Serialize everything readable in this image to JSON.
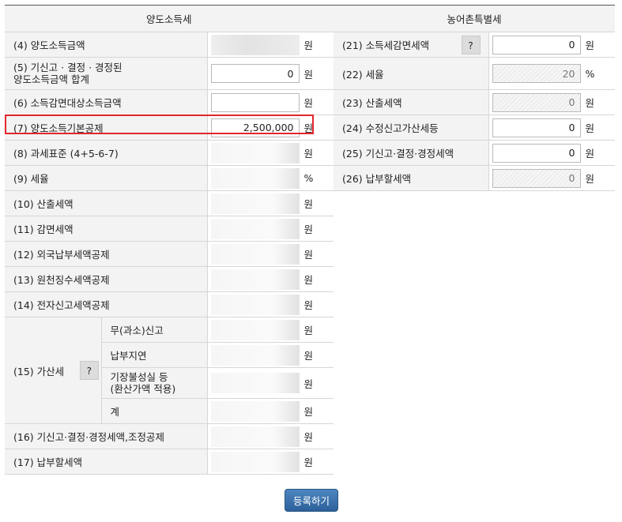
{
  "transfer_tax": {
    "header": "양도소득세",
    "rows": {
      "r4": {
        "label": "(4) 양도소득금액",
        "unit": "원"
      },
      "r5": {
        "label1": "(5) 기신고 · 결정 · 경정된",
        "label2": "양도소득금액 합계",
        "value": "0",
        "unit": "원"
      },
      "r6": {
        "label": "(6) 소득감면대상소득금액",
        "value": "",
        "unit": "원"
      },
      "r7": {
        "label": "(7) 양도소득기본공제",
        "value": "2,500,000",
        "unit": "원"
      },
      "r8": {
        "label": "(8) 과세표준 (4+5-6-7)",
        "unit": "원"
      },
      "r9": {
        "label": "(9) 세율",
        "unit": "%"
      },
      "r10": {
        "label": "(10) 산출세액",
        "unit": "원"
      },
      "r11": {
        "label": "(11) 감면세액",
        "unit": "원"
      },
      "r12": {
        "label": "(12) 외국납부세액공제",
        "unit": "원"
      },
      "r13": {
        "label": "(13) 원천징수세액공제",
        "unit": "원"
      },
      "r14": {
        "label": "(14) 전자신고세액공제",
        "unit": "원"
      },
      "r15": {
        "label": "(15) 가산세",
        "help": "?",
        "sub": [
          {
            "label": "무(과소)신고",
            "unit": "원"
          },
          {
            "label": "납부지연",
            "unit": "원"
          },
          {
            "label1": "기장불성실 등",
            "label2": "(환산가액 적용)",
            "unit": "원"
          },
          {
            "label": "계",
            "unit": "원"
          }
        ]
      },
      "r16": {
        "label": "(16) 기신고·결정·경정세액,조정공제",
        "unit": "원"
      },
      "r17": {
        "label": "(17) 납부할세액",
        "unit": "원"
      }
    }
  },
  "rural_tax": {
    "header": "농어촌특별세",
    "rows": {
      "r21": {
        "label": "(21) 소득세감면세액",
        "help": "?",
        "value": "0",
        "unit": "원"
      },
      "r22": {
        "label": "(22) 세율",
        "value": "20",
        "unit": "%"
      },
      "r23": {
        "label": "(23) 산출세액",
        "value": "0",
        "unit": "원"
      },
      "r24": {
        "label": "(24) 수정신고가산세등",
        "value": "0",
        "unit": "원"
      },
      "r25": {
        "label": "(25) 기신고·결정·경정세액",
        "value": "0",
        "unit": "원"
      },
      "r26": {
        "label": "(26) 납부할세액",
        "value": "0",
        "unit": "원"
      }
    }
  },
  "submit_label": "등록하기",
  "colors": {
    "highlight": "#e2262e",
    "button": "#3a6fa8",
    "label_bg": "#f3f3f3"
  }
}
